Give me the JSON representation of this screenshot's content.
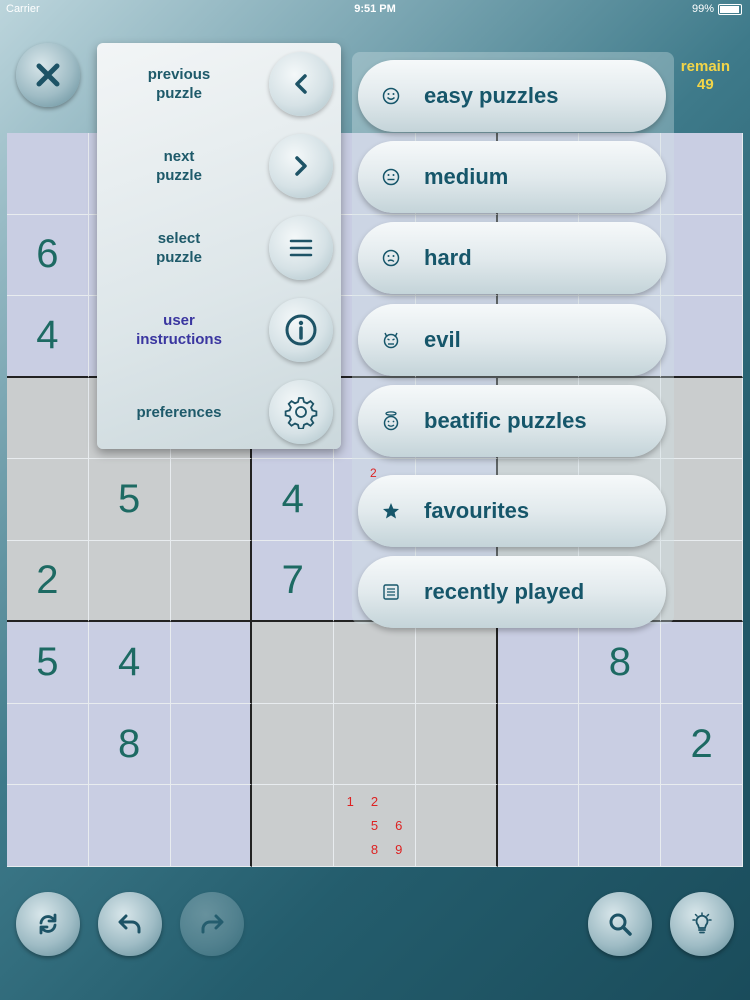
{
  "status_bar": {
    "carrier": "Carrier",
    "time": "9:51 PM",
    "battery": "99%"
  },
  "remain": {
    "label": "remain",
    "count": "49"
  },
  "menu": {
    "items": [
      {
        "label_line1": "previous",
        "label_line2": "puzzle",
        "icon": "chevron-left-icon"
      },
      {
        "label_line1": "next",
        "label_line2": "puzzle",
        "icon": "chevron-right-icon"
      },
      {
        "label_line1": "select",
        "label_line2": "puzzle",
        "icon": "list-icon"
      },
      {
        "label_line1": "user",
        "label_line2": "instructions",
        "icon": "info-icon"
      },
      {
        "label_line1": "preferences",
        "label_line2": "",
        "icon": "gear-icon"
      }
    ]
  },
  "puzzle_list": {
    "items": [
      {
        "label": "easy puzzles",
        "icon": "smile-face-icon"
      },
      {
        "label": "medium",
        "icon": "neutral-face-icon"
      },
      {
        "label": "hard",
        "icon": "worried-face-icon"
      },
      {
        "label": "evil",
        "icon": "devil-face-icon"
      },
      {
        "label": "beatific puzzles",
        "icon": "angel-face-icon"
      },
      {
        "label": "favourites",
        "icon": "star-icon"
      },
      {
        "label": "recently played",
        "icon": "list-doc-icon"
      }
    ],
    "note_above_favourites": "2"
  },
  "grid": {
    "rows": [
      [
        "",
        "",
        "",
        "",
        "",
        "",
        "",
        "",
        ""
      ],
      [
        "6",
        "",
        "",
        "",
        "",
        "",
        "",
        "",
        ""
      ],
      [
        "4",
        "",
        "",
        "",
        "",
        "",
        "",
        "",
        ""
      ],
      [
        "",
        "",
        "",
        "",
        "",
        "",
        "",
        "",
        ""
      ],
      [
        "",
        "5",
        "",
        "4",
        "",
        "",
        "",
        "",
        ""
      ],
      [
        "2",
        "",
        "",
        "7",
        "",
        "",
        "",
        "",
        ""
      ],
      [
        "5",
        "4",
        "",
        "",
        "",
        "",
        "",
        "8",
        ""
      ],
      [
        "",
        "8",
        "",
        "",
        "",
        "",
        "",
        "",
        "2"
      ],
      [
        "",
        "",
        "",
        "",
        "",
        "",
        "",
        "",
        ""
      ]
    ],
    "notes": {
      "8-4": [
        "1",
        "2",
        "",
        "",
        "5",
        "6",
        "",
        "8",
        "9"
      ]
    }
  },
  "toolbar": {
    "buttons": [
      "restart-icon",
      "undo-icon",
      "redo-icon",
      "search-icon",
      "hint-bulb-icon"
    ]
  }
}
